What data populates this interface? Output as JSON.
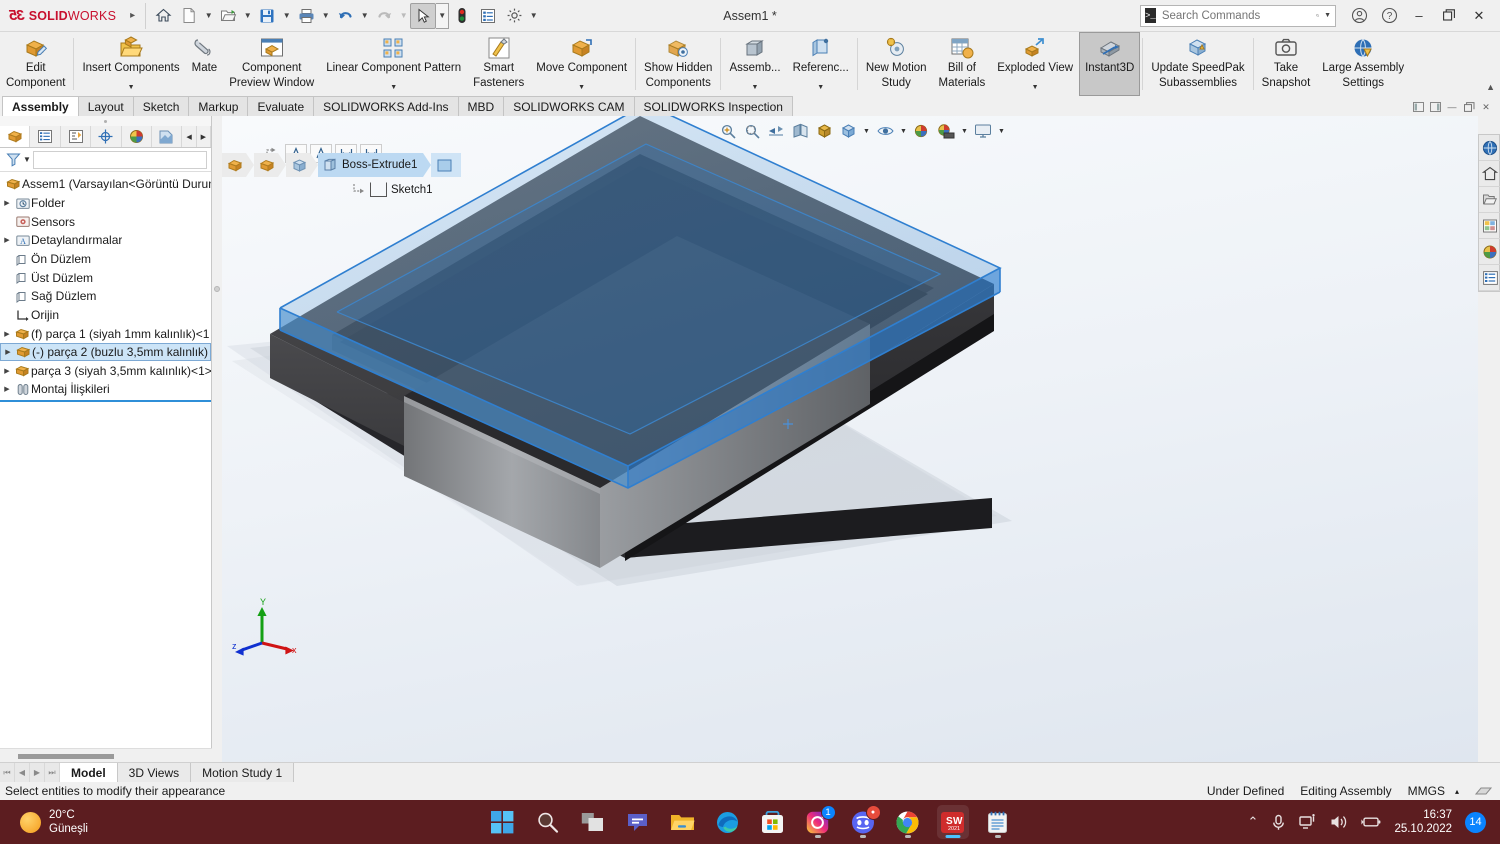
{
  "titlebar": {
    "brand_ds": "35",
    "brand_solid": "SOLID",
    "brand_works": "WORKS",
    "document_title": "Assem1 *",
    "quick_access": [
      {
        "name": "home-icon",
        "label": "Home"
      },
      {
        "name": "new-document-icon",
        "label": "New"
      },
      {
        "name": "open-folder-icon",
        "label": "Open"
      },
      {
        "name": "save-icon",
        "label": "Save"
      },
      {
        "name": "print-icon",
        "label": "Print"
      },
      {
        "name": "undo-icon",
        "label": "Undo"
      },
      {
        "name": "redo-icon",
        "label": "Redo"
      },
      {
        "name": "select-cursor-icon",
        "label": "Select"
      },
      {
        "name": "rebuild-icon",
        "label": "Rebuild"
      },
      {
        "name": "options-list-icon",
        "label": "File Properties"
      },
      {
        "name": "gear-icon",
        "label": "Options"
      }
    ],
    "search": {
      "placeholder": "Search Commands",
      "value": ""
    },
    "account_icon": "user-account-icon",
    "help_icon": "help-icon",
    "minimize_label": "–",
    "restore_label": "❐",
    "close_label": "✕"
  },
  "ribbon": {
    "items": [
      {
        "label1": "Edit",
        "label2": "Component",
        "icon": "edit-component-icon",
        "caret": false,
        "selected": false
      },
      {
        "label1": "Insert Components",
        "label2": "",
        "icon": "insert-components-icon",
        "caret": true,
        "selected": false
      },
      {
        "label1": "Mate",
        "label2": "",
        "icon": "mate-icon",
        "caret": false,
        "selected": false
      },
      {
        "label1": "Component",
        "label2": "Preview Window",
        "icon": "component-preview-icon",
        "caret": false,
        "selected": false
      },
      {
        "label1": "Linear Component Pattern",
        "label2": "",
        "icon": "linear-pattern-icon",
        "caret": true,
        "selected": false
      },
      {
        "label1": "Smart",
        "label2": "Fasteners",
        "icon": "smart-fasteners-icon",
        "caret": false,
        "selected": false
      },
      {
        "label1": "Move Component",
        "label2": "",
        "icon": "move-component-icon",
        "caret": true,
        "selected": false
      },
      {
        "label1": "Show Hidden",
        "label2": "Components",
        "icon": "show-hidden-components-icon",
        "caret": false,
        "selected": false
      },
      {
        "label1": "Assemb...",
        "label2": "",
        "icon": "assembly-features-icon",
        "caret": true,
        "selected": false
      },
      {
        "label1": "Referenc...",
        "label2": "",
        "icon": "reference-geometry-icon",
        "caret": true,
        "selected": false
      },
      {
        "label1": "New Motion",
        "label2": "Study",
        "icon": "new-motion-study-icon",
        "caret": false,
        "selected": false
      },
      {
        "label1": "Bill of",
        "label2": "Materials",
        "icon": "bill-of-materials-icon",
        "caret": false,
        "selected": false
      },
      {
        "label1": "Exploded View",
        "label2": "",
        "icon": "exploded-view-icon",
        "caret": true,
        "selected": false
      },
      {
        "label1": "Instant3D",
        "label2": "",
        "icon": "instant3d-icon",
        "caret": false,
        "selected": true
      },
      {
        "label1": "Update SpeedPak",
        "label2": "Subassemblies",
        "icon": "update-speedpak-icon",
        "caret": false,
        "selected": false
      },
      {
        "label1": "Take",
        "label2": "Snapshot",
        "icon": "take-snapshot-icon",
        "caret": false,
        "selected": false
      },
      {
        "label1": "Large Assembly",
        "label2": "Settings",
        "icon": "large-assembly-settings-icon",
        "caret": false,
        "selected": false
      }
    ],
    "collapse_caret": "▲"
  },
  "tabs": {
    "items": [
      {
        "label": "Assembly",
        "active": true
      },
      {
        "label": "Layout",
        "active": false
      },
      {
        "label": "Sketch",
        "active": false
      },
      {
        "label": "Markup",
        "active": false
      },
      {
        "label": "Evaluate",
        "active": false
      },
      {
        "label": "SOLIDWORKS Add-Ins",
        "active": false
      },
      {
        "label": "MBD",
        "active": false
      },
      {
        "label": "SOLIDWORKS CAM",
        "active": false
      },
      {
        "label": "SOLIDWORKS Inspection",
        "active": false
      }
    ],
    "window_controls": [
      "◨",
      "◩",
      "–",
      "❐",
      "✕"
    ]
  },
  "tree": {
    "panel_tabs": [
      {
        "name": "feature-manager-tab",
        "selected": true
      },
      {
        "name": "property-manager-tab",
        "selected": false
      },
      {
        "name": "configuration-manager-tab",
        "selected": false
      },
      {
        "name": "dimxpert-manager-tab",
        "selected": false
      },
      {
        "name": "display-manager-tab",
        "selected": false
      },
      {
        "name": "appearances-tab",
        "selected": false
      }
    ],
    "filter_placeholder": "",
    "nodes": [
      {
        "label": "Assem1  (Varsayılan<Görüntü Durum",
        "icon": "assembly-icon",
        "indent": 0,
        "arrow": false,
        "selected": false
      },
      {
        "label": "Folder",
        "icon": "history-folder-icon",
        "indent": 1,
        "arrow": true,
        "selected": false
      },
      {
        "label": "Sensors",
        "icon": "sensors-icon",
        "indent": 1,
        "arrow": false,
        "selected": false
      },
      {
        "label": "Detaylandırmalar",
        "icon": "annotations-icon",
        "indent": 1,
        "arrow": true,
        "selected": false
      },
      {
        "label": "Ön Düzlem",
        "icon": "plane-icon",
        "indent": 1,
        "arrow": false,
        "selected": false
      },
      {
        "label": "Üst Düzlem",
        "icon": "plane-icon",
        "indent": 1,
        "arrow": false,
        "selected": false
      },
      {
        "label": "Sağ Düzlem",
        "icon": "plane-icon",
        "indent": 1,
        "arrow": false,
        "selected": false
      },
      {
        "label": "Orijin",
        "icon": "origin-icon",
        "indent": 1,
        "arrow": false,
        "selected": false
      },
      {
        "label": "(f) parça 1 (siyah 1mm kalınlık)<1",
        "icon": "part-icon",
        "indent": 1,
        "arrow": true,
        "selected": false
      },
      {
        "label": "(-) parça 2 (buzlu 3,5mm kalınlık)",
        "icon": "part-icon",
        "indent": 1,
        "arrow": true,
        "selected": true
      },
      {
        "label": "parça 3 (siyah 3,5mm kalınlık)<1>",
        "icon": "part-icon",
        "indent": 1,
        "arrow": true,
        "selected": false
      },
      {
        "label": "Montaj İlişkileri",
        "icon": "mates-icon",
        "indent": 1,
        "arrow": true,
        "selected": false
      }
    ]
  },
  "graphics": {
    "view_toolbar": [
      {
        "name": "zoom-to-fit-icon",
        "caret": false
      },
      {
        "name": "zoom-to-area-icon",
        "caret": false
      },
      {
        "name": "previous-view-icon",
        "caret": false
      },
      {
        "name": "section-view-icon",
        "caret": false
      },
      {
        "name": "view-orientation-icon",
        "caret": false
      },
      {
        "name": "display-style-icon",
        "caret": true
      },
      {
        "name": "view-setting-cube-icon",
        "caret": true
      },
      {
        "name": "hide-show-items-icon",
        "caret": true
      },
      {
        "name": "edit-appearance-icon",
        "caret": false
      },
      {
        "name": "apply-scene-icon",
        "caret": true
      },
      {
        "name": "view-settings-screen-icon",
        "caret": true
      }
    ],
    "sketch_tools": [
      {
        "name": "exit-context-icon"
      },
      {
        "name": "smart-dimension-icon"
      },
      {
        "name": "angle-dimension-icon"
      },
      {
        "name": "horizontal-dimension-icon"
      },
      {
        "name": "vertical-dimension-icon"
      }
    ],
    "breadcrumb": [
      {
        "name": "assembly-chip",
        "label": "",
        "icon": "assembly-icon"
      },
      {
        "name": "part-chip",
        "label": "",
        "icon": "part-icon"
      },
      {
        "name": "solid-bodies-chip",
        "label": "",
        "icon": "solid-body-icon"
      },
      {
        "name": "feature-chip",
        "label": "Boss-Extrude1",
        "icon": "boss-extrude-icon"
      },
      {
        "name": "face-chip",
        "label": "",
        "icon": "face-icon"
      }
    ],
    "sketch_node": "Sketch1",
    "triad": {
      "x": "x",
      "y": "Y",
      "z": "z"
    },
    "model_colors": {
      "tray_dark": "#3a3a3c",
      "tray_top": "#1c1c1e",
      "block_grey": "#8d8f92",
      "selected_blue": "#5a9bd5",
      "selected_edge": "#2f7fd0",
      "background_top": "#f8fafc",
      "background_bottom": "#dfe6ef"
    }
  },
  "task_pane": {
    "items": [
      {
        "name": "solidworks-resources-icon"
      },
      {
        "name": "design-library-icon"
      },
      {
        "name": "file-explorer-icon"
      },
      {
        "name": "view-palette-icon"
      },
      {
        "name": "appearances-scenes-decals-icon"
      },
      {
        "name": "custom-properties-icon"
      }
    ]
  },
  "bottom_tabs": {
    "nav": [
      "⏮",
      "◀",
      "▶",
      "⏭"
    ],
    "items": [
      {
        "label": "Model",
        "active": true
      },
      {
        "label": "3D Views",
        "active": false
      },
      {
        "label": "Motion Study 1",
        "active": false
      }
    ]
  },
  "status_bar": {
    "message": "Select entities to modify their appearance",
    "state": "Under Defined",
    "mode": "Editing Assembly",
    "units": "MMGS",
    "units_caret": "▴",
    "tools_icon": "sensor-status-icon"
  },
  "taskbar": {
    "weather": {
      "temp": "20°C",
      "condition": "Güneşli",
      "icon": "sun-icon"
    },
    "apps": [
      {
        "name": "start-button-icon",
        "label": "Start",
        "running": false,
        "active": false,
        "badge": ""
      },
      {
        "name": "search-icon",
        "label": "Search",
        "running": false,
        "active": false,
        "badge": ""
      },
      {
        "name": "task-view-icon",
        "label": "Task View",
        "running": false,
        "active": false,
        "badge": ""
      },
      {
        "name": "microsoft-teams-icon",
        "label": "Chat",
        "running": false,
        "active": false,
        "badge": ""
      },
      {
        "name": "file-explorer-icon",
        "label": "File Explorer",
        "running": false,
        "active": false,
        "badge": ""
      },
      {
        "name": "microsoft-edge-icon",
        "label": "Microsoft Edge",
        "running": false,
        "active": false,
        "badge": ""
      },
      {
        "name": "microsoft-store-icon",
        "label": "Microsoft Store",
        "running": false,
        "active": false,
        "badge": ""
      },
      {
        "name": "instagram-icon",
        "label": "Instagram",
        "running": true,
        "active": false,
        "badge": "1"
      },
      {
        "name": "discord-icon",
        "label": "Discord",
        "running": true,
        "active": false,
        "badge": "●"
      },
      {
        "name": "google-chrome-icon",
        "label": "Google Chrome",
        "running": true,
        "active": false,
        "badge": ""
      },
      {
        "name": "solidworks-icon",
        "label": "SOLIDWORKS 2021",
        "running": true,
        "active": true,
        "badge": ""
      },
      {
        "name": "notepad-icon",
        "label": "Notepad",
        "running": true,
        "active": false,
        "badge": ""
      }
    ],
    "tray": [
      {
        "name": "show-hidden-icons-chevron",
        "glyph": "⌃"
      },
      {
        "name": "microphone-icon",
        "glyph": ""
      },
      {
        "name": "network-icon",
        "glyph": ""
      },
      {
        "name": "volume-icon",
        "glyph": ""
      },
      {
        "name": "battery-icon",
        "glyph": ""
      }
    ],
    "clock": {
      "time": "16:37",
      "date": "25.10.2022"
    },
    "notification_count": "14"
  }
}
